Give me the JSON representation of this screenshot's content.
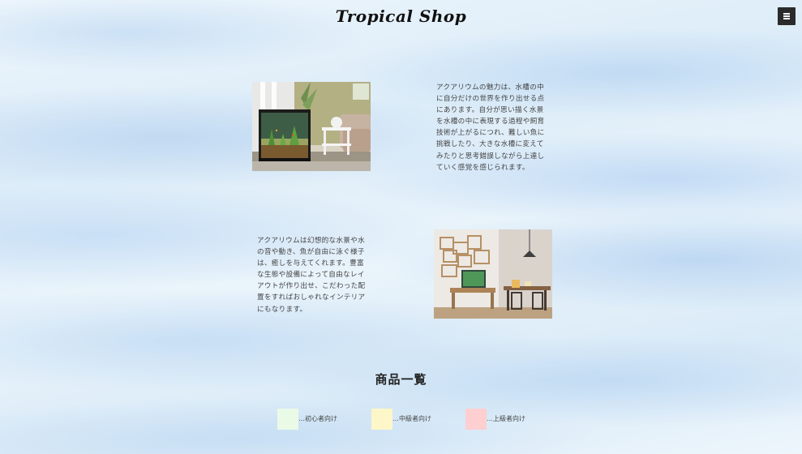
{
  "header": {
    "logo_text": "Tropical Shop",
    "menu_icon": "hamburger-menu-icon"
  },
  "intro": [
    {
      "image_alt": "アクアリウム水槽の写真",
      "text": "アクアリウムの魅力は、水槽の中に自分だけの世界を作り出せる点にあります。自分が思い描く水景を水槽の中に表現する過程や飼育技術が上がるにつれ、難しい魚に挑戦したり、大きな水槽に変えてみたりと思考錯誤しながら上達していく感覚を感じられます。"
    },
    {
      "image_alt": "インテリアとしての水槽の写真",
      "text": "アクアリウムは幻想的な水景や水の音や動き、魚が自由に泳ぐ様子は、癒しを与えてくれます。豊富な生態や設備によって自由なレイアウトが作り出せ、こだわった配置をすればおしゃれなインテリアにもなります。"
    }
  ],
  "products": {
    "title": "商品一覧",
    "legend": [
      {
        "label": "…初心者向け",
        "color": "#e9fbe6"
      },
      {
        "label": "…中級者向け",
        "color": "#fdf6c8"
      },
      {
        "label": "…上級者向け",
        "color": "#fdcfd0"
      }
    ]
  }
}
